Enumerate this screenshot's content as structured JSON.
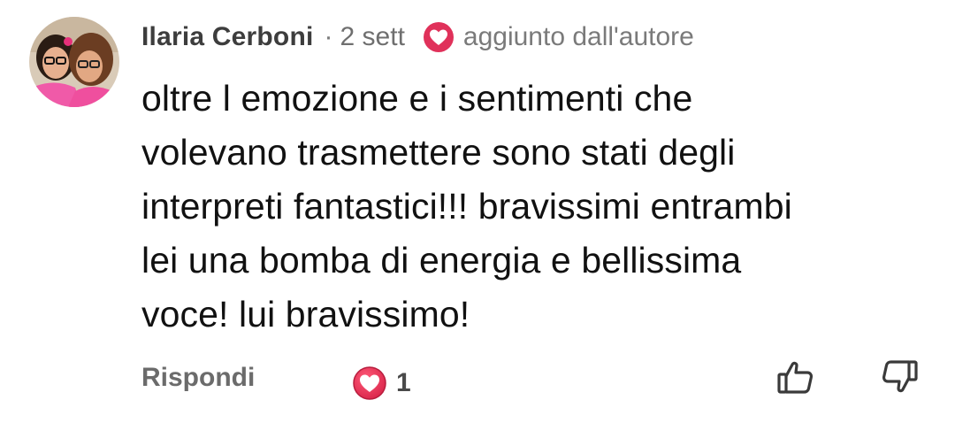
{
  "comment": {
    "author": "Ilaria Cerboni",
    "separator": "·",
    "time": "2 sett",
    "author_badge_icon": "heart-icon",
    "author_tag": "aggiunto dall'autore",
    "text": "oltre l emozione e i sentimenti che\nvolevano trasmettere sono stati degli\ninterpreti fantastici!!! bravissimi entrambi\nlei una bomba di energia e bellissima\nvoce! lui bravissimo!",
    "reply_label": "Rispondi",
    "likes": "1",
    "like_icon": "heart-icon",
    "thumb_up_icon": "thumb-up-icon",
    "thumb_down_icon": "thumb-down-icon"
  },
  "colors": {
    "accent": "#e0315a",
    "text_primary": "#111111",
    "text_secondary": "#6f6f6f"
  }
}
